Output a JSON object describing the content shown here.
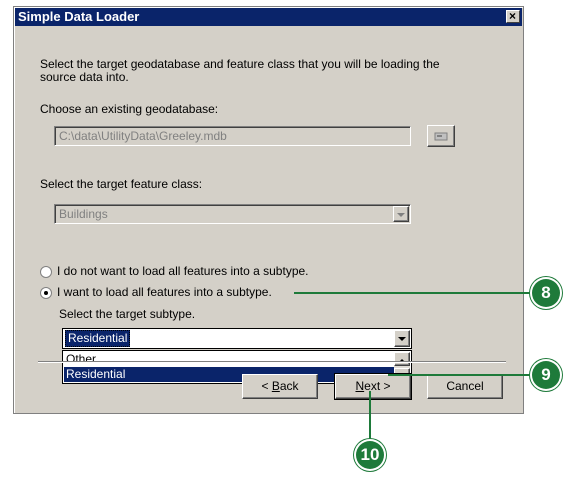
{
  "window": {
    "title": "Simple Data Loader",
    "close_symbol": "×"
  },
  "intro_text_line1": "Select the target geodatabase and feature class that you will be loading the",
  "intro_text_line2": "source data into.",
  "geodatabase": {
    "label": "Choose an existing geodatabase:",
    "value": "C:\\data\\UtilityData\\Greeley.mdb"
  },
  "feature_class": {
    "label": "Select the target feature class:",
    "value": "Buildings"
  },
  "subtype_options": [
    {
      "label": "I do not want to load all features into a subtype.",
      "selected": false
    },
    {
      "label": "I want to load all features into a subtype.",
      "selected": true
    }
  ],
  "target_subtype": {
    "label": "Select the target subtype.",
    "value": "Residential",
    "list_items": [
      "Other",
      "Residential"
    ],
    "selected_item": "Residential"
  },
  "buttons": {
    "back_prefix": "< ",
    "back_mnemonic": "B",
    "back_rest": "ack",
    "next_mnemonic": "N",
    "next_rest": "ext >",
    "cancel": "Cancel"
  },
  "callouts": [
    "8",
    "9",
    "10"
  ],
  "colors": {
    "titlebar": "#0a246a",
    "dialog_face": "#d4d0c8",
    "callout": "#1e7a3a"
  }
}
